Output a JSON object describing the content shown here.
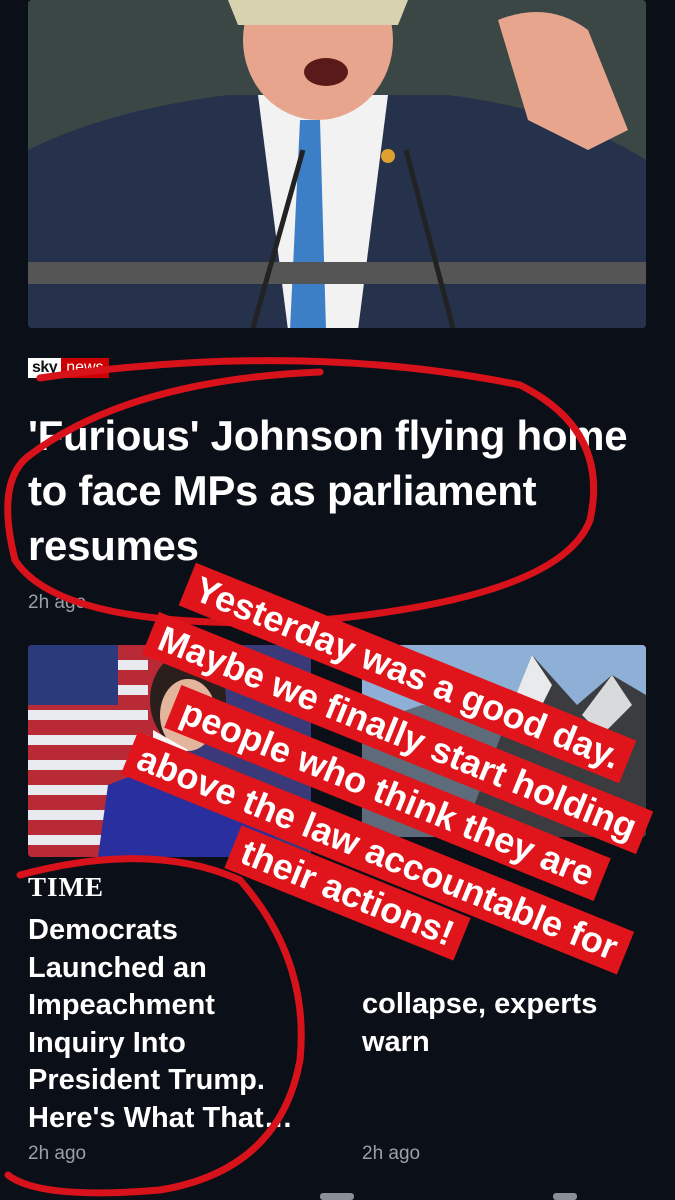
{
  "hero": {
    "publisher_logo_text": "sky",
    "publisher_logo_text_2": "news",
    "headline": "'Furious' Johnson flying home to face MPs as parliament resumes",
    "time": "2h ago"
  },
  "cards": [
    {
      "publisher": "TIME",
      "headline": "Democrats Launched an Impeachment Inquiry Into President Trump. Here's What That…",
      "time": "2h ago"
    },
    {
      "headline": "collapse, experts warn",
      "time": "2h ago"
    }
  ],
  "story_overlay": {
    "lines": [
      "Yesterday was a good day.",
      "Maybe we finally start holding",
      "people who think they are",
      "above the law accountable for",
      "their actions!"
    ],
    "colors": {
      "background": "#e0141b",
      "text": "#ffffff",
      "circle": "#d8121a"
    }
  },
  "colors": {
    "page_bg": "#0b0f17",
    "muted_text": "#9aa0a8"
  }
}
